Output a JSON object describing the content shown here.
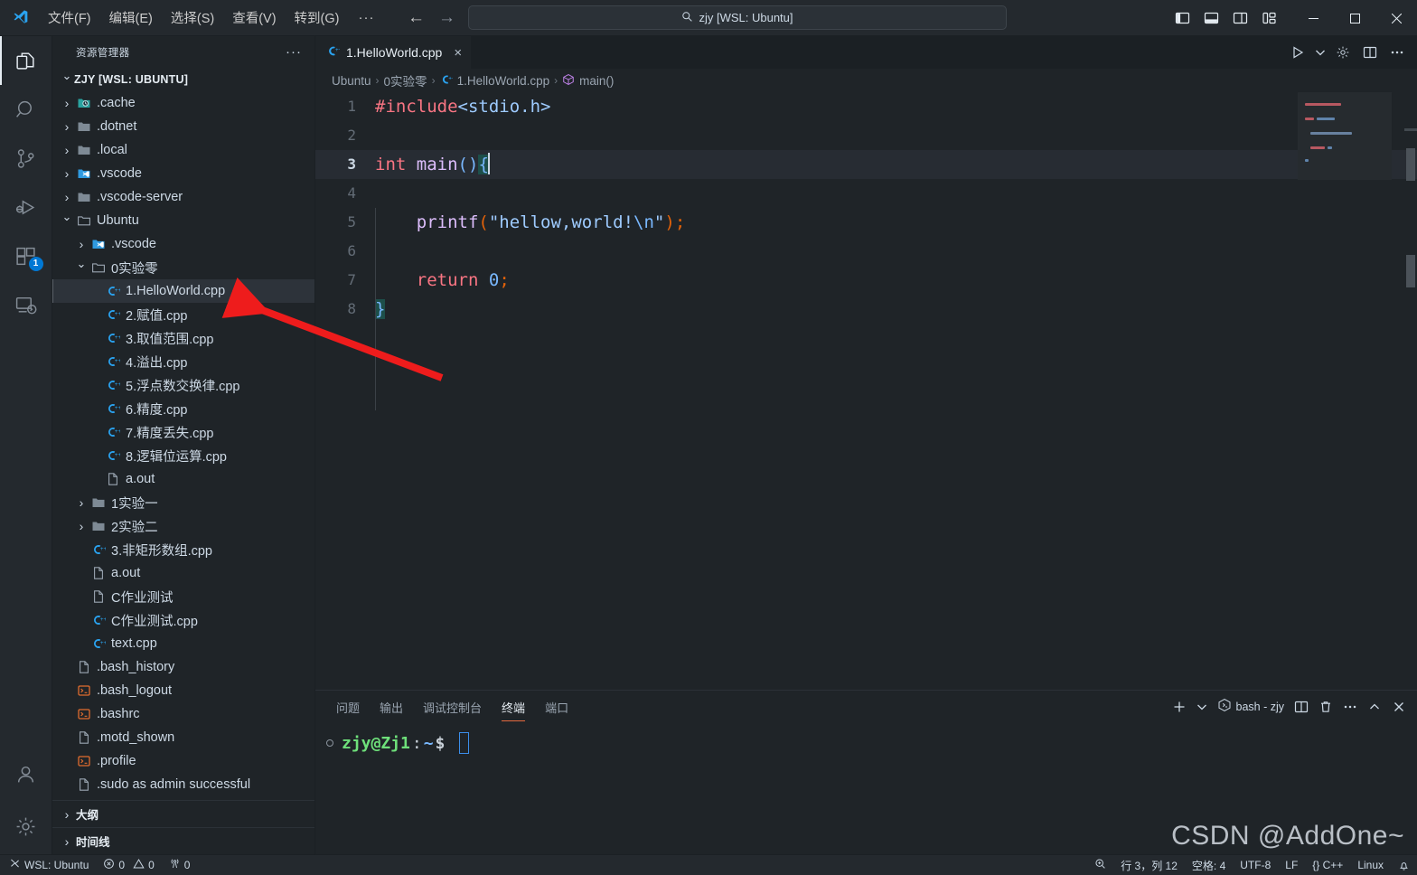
{
  "titlebar": {
    "menus": [
      "文件(F)",
      "编辑(E)",
      "选择(S)",
      "查看(V)",
      "转到(G)"
    ],
    "more": "···",
    "back_icon": "arrow-left-icon",
    "forward_icon": "arrow-right-icon",
    "search": {
      "icon": "search-icon",
      "value": "zjy [WSL: Ubuntu]"
    },
    "layout_buttons": [
      "toggle-primary-sidebar-icon",
      "toggle-panel-icon",
      "toggle-secondary-sidebar-icon",
      "customize-layout-icon"
    ],
    "window_controls": [
      "minimize-icon",
      "maximize-icon",
      "close-icon"
    ]
  },
  "activitybar": {
    "items": [
      {
        "name": "explorer",
        "icon": "files-icon",
        "active": true
      },
      {
        "name": "search",
        "icon": "search-icon",
        "active": false
      },
      {
        "name": "source-control",
        "icon": "source-control-icon",
        "active": false
      },
      {
        "name": "run-debug",
        "icon": "run-and-debug-icon",
        "active": false
      },
      {
        "name": "extensions",
        "icon": "extensions-icon",
        "active": false,
        "badge": "1"
      },
      {
        "name": "remote-explorer",
        "icon": "remote-explorer-icon",
        "active": false
      }
    ],
    "bottom": [
      {
        "name": "accounts",
        "icon": "account-icon"
      },
      {
        "name": "settings",
        "icon": "gear-icon"
      }
    ]
  },
  "sidebar": {
    "title": "资源管理器",
    "more": "···",
    "root": "ZJY [WSL: UBUNTU]",
    "tree": [
      {
        "label": ".cache",
        "indent": 1,
        "type": "folder-cache",
        "state": "closed"
      },
      {
        "label": ".dotnet",
        "indent": 1,
        "type": "folder",
        "state": "closed"
      },
      {
        "label": ".local",
        "indent": 1,
        "type": "folder",
        "state": "closed"
      },
      {
        "label": ".vscode",
        "indent": 1,
        "type": "folder-vscode",
        "state": "closed"
      },
      {
        "label": ".vscode-server",
        "indent": 1,
        "type": "folder",
        "state": "closed"
      },
      {
        "label": "Ubuntu",
        "indent": 1,
        "type": "folder-open",
        "state": "open"
      },
      {
        "label": ".vscode",
        "indent": 2,
        "type": "folder-vscode",
        "state": "closed"
      },
      {
        "label": "0实验零",
        "indent": 2,
        "type": "folder-open",
        "state": "open"
      },
      {
        "label": "1.HelloWorld.cpp",
        "indent": 3,
        "type": "cpp",
        "state": "none",
        "selected": true
      },
      {
        "label": "2.赋值.cpp",
        "indent": 3,
        "type": "cpp",
        "state": "none"
      },
      {
        "label": "3.取值范围.cpp",
        "indent": 3,
        "type": "cpp",
        "state": "none"
      },
      {
        "label": "4.溢出.cpp",
        "indent": 3,
        "type": "cpp",
        "state": "none"
      },
      {
        "label": "5.浮点数交换律.cpp",
        "indent": 3,
        "type": "cpp",
        "state": "none"
      },
      {
        "label": "6.精度.cpp",
        "indent": 3,
        "type": "cpp",
        "state": "none"
      },
      {
        "label": "7.精度丢失.cpp",
        "indent": 3,
        "type": "cpp",
        "state": "none"
      },
      {
        "label": "8.逻辑位运算.cpp",
        "indent": 3,
        "type": "cpp",
        "state": "none"
      },
      {
        "label": "a.out",
        "indent": 3,
        "type": "file",
        "state": "none"
      },
      {
        "label": "1实验一",
        "indent": 2,
        "type": "folder",
        "state": "closed"
      },
      {
        "label": "2实验二",
        "indent": 2,
        "type": "folder",
        "state": "closed"
      },
      {
        "label": "3.非矩形数组.cpp",
        "indent": 2,
        "type": "cpp",
        "state": "none"
      },
      {
        "label": "a.out",
        "indent": 2,
        "type": "file",
        "state": "none"
      },
      {
        "label": "C作业测试",
        "indent": 2,
        "type": "file",
        "state": "none"
      },
      {
        "label": "C作业测试.cpp",
        "indent": 2,
        "type": "cpp",
        "state": "none"
      },
      {
        "label": "text.cpp",
        "indent": 2,
        "type": "cpp",
        "state": "none"
      },
      {
        "label": ".bash_history",
        "indent": 1,
        "type": "file",
        "state": "none"
      },
      {
        "label": ".bash_logout",
        "indent": 1,
        "type": "shell",
        "state": "none"
      },
      {
        "label": ".bashrc",
        "indent": 1,
        "type": "shell",
        "state": "none"
      },
      {
        "label": ".motd_shown",
        "indent": 1,
        "type": "file",
        "state": "none"
      },
      {
        "label": ".profile",
        "indent": 1,
        "type": "shell",
        "state": "none"
      },
      {
        "label": ".sudo as admin successful",
        "indent": 1,
        "type": "file",
        "state": "none"
      }
    ],
    "sections": [
      {
        "label": "大纲",
        "state": "closed"
      },
      {
        "label": "时间线",
        "state": "closed"
      }
    ]
  },
  "editor": {
    "tab": {
      "label": "1.HelloWorld.cpp",
      "icon": "cpp-file-icon",
      "close": "×"
    },
    "actions": [
      "run-icon",
      "chevron-down-icon",
      "gear-icon",
      "split-editor-icon",
      "more-actions-icon"
    ],
    "breadcrumb": [
      {
        "label": "Ubuntu",
        "icon": ""
      },
      {
        "label": "0实验零",
        "icon": ""
      },
      {
        "label": "1.HelloWorld.cpp",
        "icon": "cpp-file-icon"
      },
      {
        "label": "main()",
        "icon": "symbol-method-icon"
      }
    ],
    "lines": [
      {
        "n": "1",
        "current": false,
        "tokens": [
          {
            "t": "#include",
            "c": "tk-pre"
          },
          {
            "t": "<stdio.h>",
            "c": "tk-hdr"
          }
        ]
      },
      {
        "n": "2",
        "current": false,
        "tokens": []
      },
      {
        "n": "3",
        "current": true,
        "tokens": [
          {
            "t": "int",
            "c": "tk-kw"
          },
          {
            "t": " ",
            "c": "tk-op"
          },
          {
            "t": "main",
            "c": "tk-fn"
          },
          {
            "t": "()",
            "c": "tk-par"
          },
          {
            "t": "{",
            "c": "tk-par brmatch"
          }
        ],
        "caret": true
      },
      {
        "n": "4",
        "current": false,
        "tokens": []
      },
      {
        "n": "5",
        "current": false,
        "tokens": [
          {
            "t": "    ",
            "c": "tk-op"
          },
          {
            "t": "printf",
            "c": "tk-fn"
          },
          {
            "t": "(",
            "c": "tk-semi"
          },
          {
            "t": "\"hellow,world!",
            "c": "tk-str"
          },
          {
            "t": "\\n",
            "c": "tk-esc"
          },
          {
            "t": "\"",
            "c": "tk-str"
          },
          {
            "t": ")",
            "c": "tk-semi"
          },
          {
            "t": ";",
            "c": "tk-semi"
          }
        ]
      },
      {
        "n": "6",
        "current": false,
        "tokens": []
      },
      {
        "n": "7",
        "current": false,
        "tokens": [
          {
            "t": "    ",
            "c": "tk-op"
          },
          {
            "t": "return",
            "c": "tk-kw"
          },
          {
            "t": " ",
            "c": "tk-op"
          },
          {
            "t": "0",
            "c": "tk-num"
          },
          {
            "t": ";",
            "c": "tk-semi"
          }
        ]
      },
      {
        "n": "8",
        "current": false,
        "tokens": [
          {
            "t": "}",
            "c": "tk-par brmatch"
          }
        ]
      }
    ]
  },
  "panel": {
    "tabs": [
      {
        "label": "问题",
        "active": false
      },
      {
        "label": "输出",
        "active": false
      },
      {
        "label": "调试控制台",
        "active": false
      },
      {
        "label": "终端",
        "active": true
      },
      {
        "label": "端口",
        "active": false
      }
    ],
    "actions": {
      "new_terminal": "plus-icon",
      "dropdown": "chevron-down-icon",
      "shell_icon": "terminal-bash-icon",
      "shell_label": "bash - zjy",
      "split": "split-terminal-icon",
      "kill": "trash-icon",
      "more": "more-actions-icon",
      "maximize": "chevron-up-icon",
      "close": "close-icon"
    },
    "terminal": {
      "user_host": "zjy@Zj1",
      "colon": ":",
      "path": "~",
      "dollar": "$"
    }
  },
  "statusbar": {
    "left": [
      {
        "name": "remote-indicator",
        "icon": "remote-icon",
        "label": "WSL: Ubuntu"
      },
      {
        "name": "problems",
        "icon": "error-icon",
        "label": "0",
        "icon2": "warning-icon",
        "label2": "0"
      },
      {
        "name": "ports",
        "icon": "radio-tower-icon",
        "label": "0"
      }
    ],
    "right": [
      {
        "name": "zoom-indicator",
        "icon": "zoom-icon",
        "label": ""
      },
      {
        "name": "cursor-position",
        "label": "行 3，列 12"
      },
      {
        "name": "indentation",
        "label": "空格: 4"
      },
      {
        "name": "encoding",
        "label": "UTF-8"
      },
      {
        "name": "eol",
        "label": "LF"
      },
      {
        "name": "language-mode",
        "label": "{} C++"
      },
      {
        "name": "platform",
        "label": "Linux"
      },
      {
        "name": "notifications",
        "icon": "bell-icon",
        "label": ""
      }
    ]
  },
  "overlay": {
    "watermark": "CSDN @AddOne~",
    "arrow_color": "#ee1c1c"
  }
}
